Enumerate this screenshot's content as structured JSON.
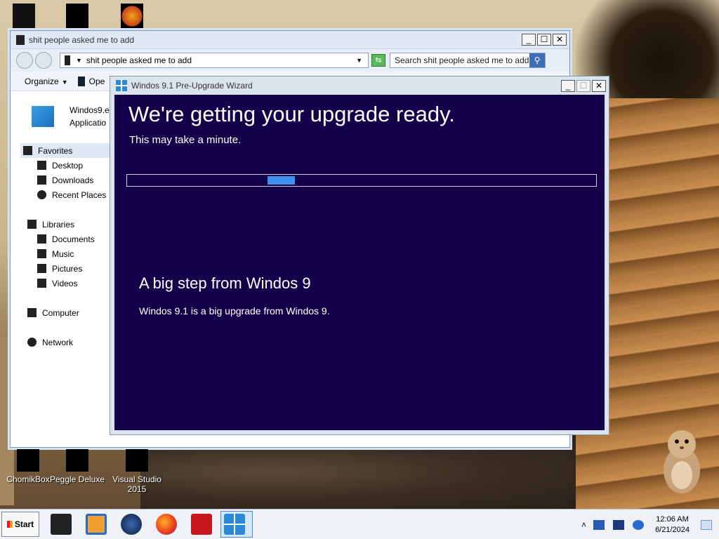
{
  "explorer": {
    "title": "shit people asked me to add",
    "address": "shit people asked me to add",
    "search_placeholder": "Search shit people asked me to add",
    "toolbar": {
      "organize": "Organize",
      "open": "Ope"
    },
    "file": {
      "name": "Windos9.e",
      "type": "Applicatio"
    },
    "nav": {
      "favorites": "Favorites",
      "desktop": "Desktop",
      "downloads": "Downloads",
      "recent": "Recent Places",
      "libraries": "Libraries",
      "documents": "Documents",
      "music": "Music",
      "pictures": "Pictures",
      "videos": "Videos",
      "computer": "Computer",
      "network": "Network"
    }
  },
  "wizard": {
    "title": "Windos 9.1 Pre-Upgrade Wizard",
    "heading": "We're getting your upgrade ready.",
    "subheading": "This may take a minute.",
    "section_title": "A big step from Windos 9",
    "section_text": "Windos 9.1 is a big upgrade from Windos 9.",
    "progress_chunk_start": 0.3,
    "colors": {
      "background": "#13024a",
      "progress": "#3d8ff0"
    }
  },
  "desktop_icons": [
    {
      "label": "ChomikBox"
    },
    {
      "label": "Peggle Deluxe"
    },
    {
      "label": "Visual Studio 2015"
    }
  ],
  "taskbar": {
    "start_label": "Start",
    "apps": [
      "terminal-icon",
      "media-player-icon",
      "globe-icon",
      "firefox-icon",
      "acrobat-icon",
      "windows-logo-icon"
    ],
    "clock_time": "12:06 AM",
    "clock_date": "6/21/2024",
    "tray_chevron": "˄"
  }
}
